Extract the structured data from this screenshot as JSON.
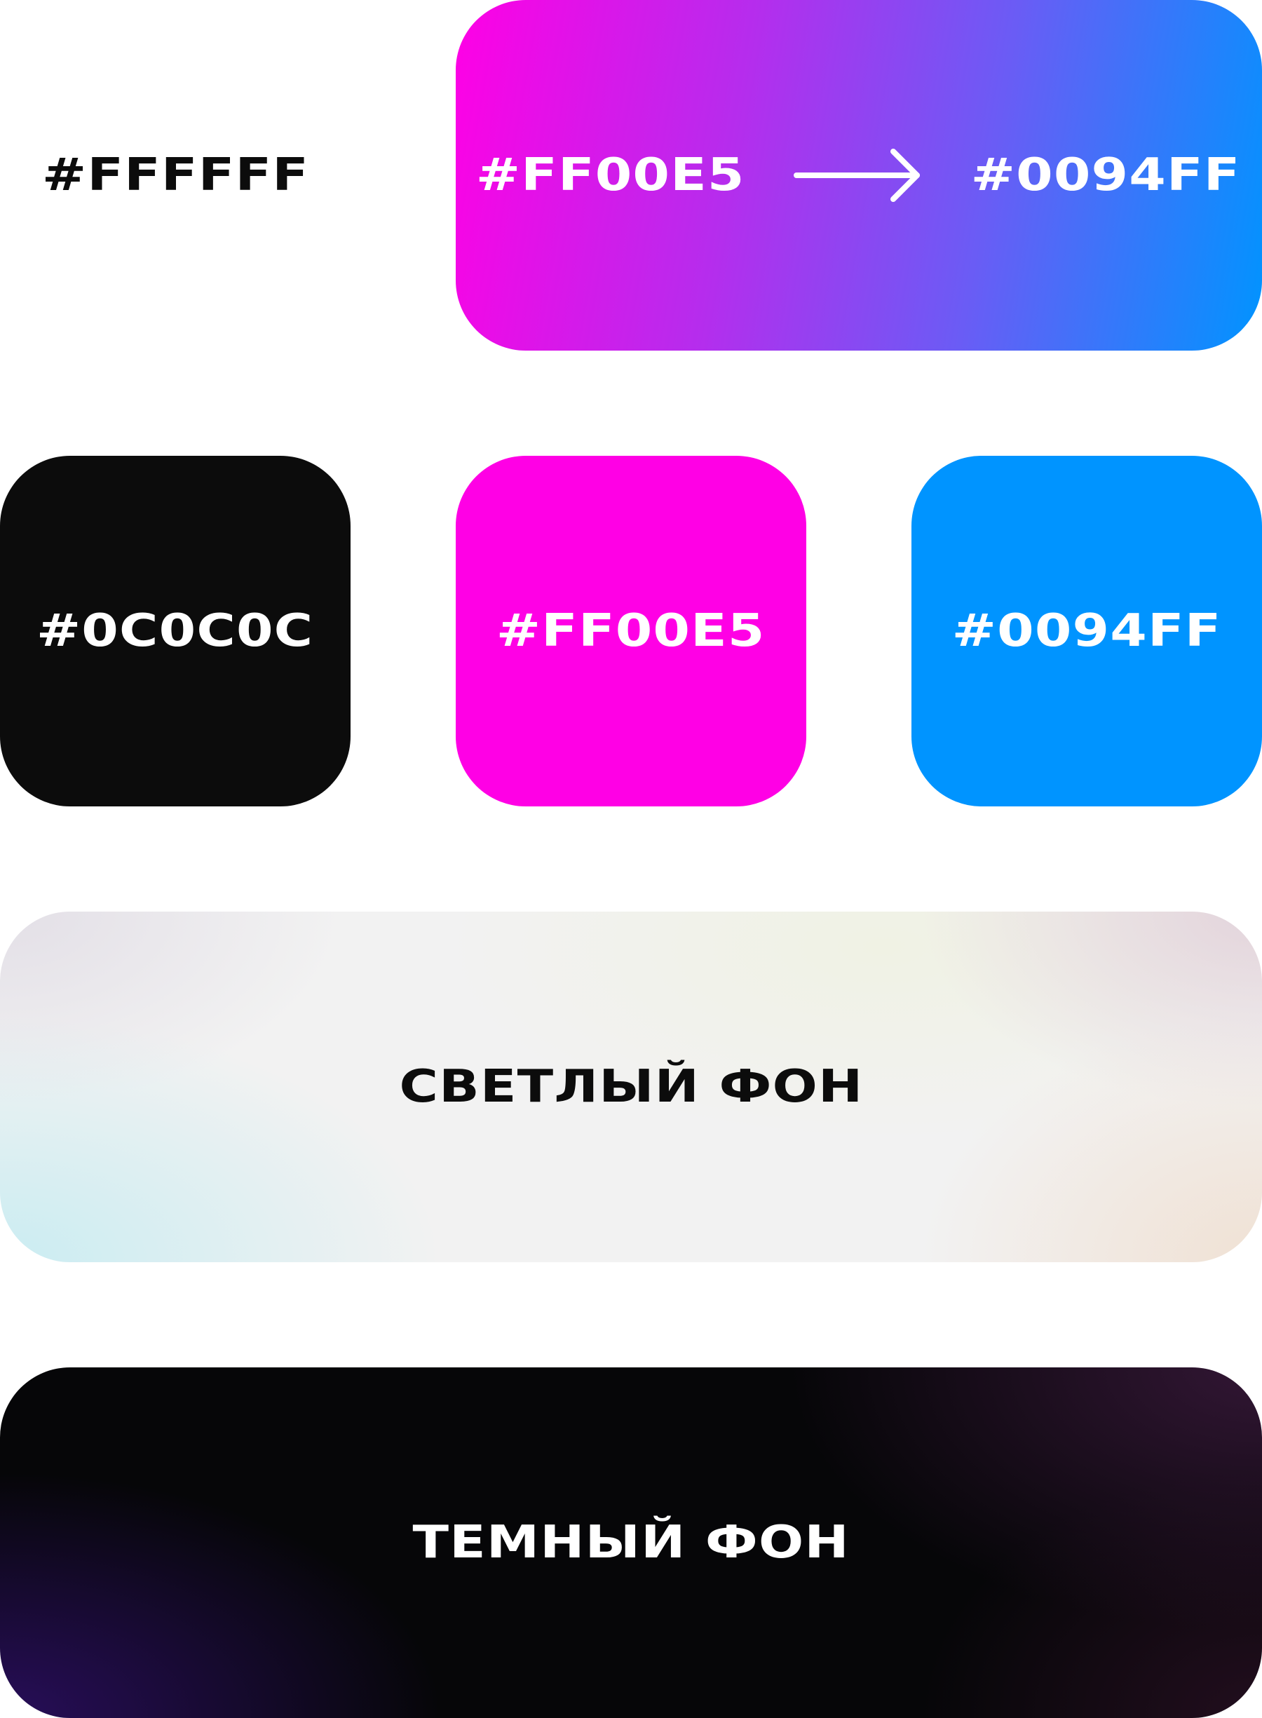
{
  "swatches": {
    "white": {
      "label": "#FFFFFF"
    },
    "gradient": {
      "from_label": "#FF00E5",
      "to_label": "#0094FF",
      "icon": "arrow-right-icon"
    },
    "black": {
      "label": "#0C0C0C"
    },
    "pink": {
      "label": "#FF00E5"
    },
    "blue": {
      "label": "#0094FF"
    }
  },
  "backgrounds": {
    "light": {
      "label": "СВЕТЛЫЙ ФОН"
    },
    "dark": {
      "label": "ТЕМНЫЙ ФОН"
    }
  },
  "colors": {
    "white": "#FFFFFF",
    "black": "#0C0C0C",
    "pink": "#FF00E5",
    "blue": "#0094FF"
  }
}
